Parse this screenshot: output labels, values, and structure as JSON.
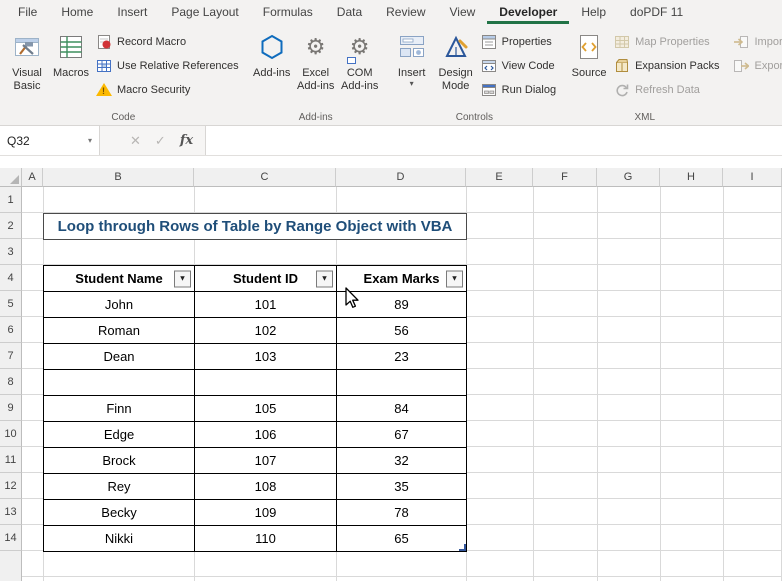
{
  "tabs": [
    {
      "label": "File"
    },
    {
      "label": "Home"
    },
    {
      "label": "Insert"
    },
    {
      "label": "Page Layout"
    },
    {
      "label": "Formulas"
    },
    {
      "label": "Data"
    },
    {
      "label": "Review"
    },
    {
      "label": "View"
    },
    {
      "label": "Developer",
      "active": true
    },
    {
      "label": "Help"
    },
    {
      "label": "doPDF 11"
    }
  ],
  "ribbon": {
    "code": {
      "group_label": "Code",
      "visual_basic": "Visual Basic",
      "macros": "Macros",
      "record_macro": "Record Macro",
      "use_relative_references": "Use Relative References",
      "macro_security": "Macro Security"
    },
    "addins": {
      "group_label": "Add-ins",
      "office_addins": "Add-ins",
      "excel_addins": "Excel Add-ins",
      "com_addins": "COM Add-ins"
    },
    "controls": {
      "group_label": "Controls",
      "insert": "Insert",
      "design_mode": "Design Mode",
      "properties": "Properties",
      "view_code": "View Code",
      "run_dialog": "Run Dialog"
    },
    "xml": {
      "group_label": "XML",
      "source": "Source",
      "map_properties": "Map Properties",
      "expansion_packs": "Expansion Packs",
      "refresh_data": "Refresh Data",
      "import": "Import",
      "export": "Export"
    }
  },
  "formula_bar": {
    "name_box": "Q32",
    "cancel": "✕",
    "enter": "✓",
    "insert_function": "fx",
    "formula_value": ""
  },
  "grid": {
    "column_headers": [
      "A",
      "B",
      "C",
      "D",
      "E",
      "F",
      "G",
      "H",
      "I"
    ],
    "row_headers": [
      "1",
      "2",
      "3",
      "4",
      "5",
      "6",
      "7",
      "8",
      "9",
      "10",
      "11",
      "12",
      "13",
      "14"
    ]
  },
  "sheet": {
    "title": "Loop through Rows of Table by Range Object with VBA",
    "table": {
      "headers": [
        "Student Name",
        "Student ID",
        "Exam Marks"
      ],
      "rows": [
        [
          "John",
          "101",
          "89"
        ],
        [
          "Roman",
          "102",
          "56"
        ],
        [
          "Dean",
          "103",
          "23"
        ],
        [
          "",
          "",
          ""
        ],
        [
          "Finn",
          "105",
          "84"
        ],
        [
          "Edge",
          "106",
          "67"
        ],
        [
          "Brock",
          "107",
          "32"
        ],
        [
          "Rey",
          "108",
          "35"
        ],
        [
          "Becky",
          "109",
          "78"
        ],
        [
          "Nikki",
          "110",
          "65"
        ]
      ]
    }
  },
  "icons": {
    "caret_down": "▾",
    "gear": "⚙",
    "exclamation": "!"
  },
  "colors": {
    "accent_green": "#217346",
    "title_text": "#1f4e79",
    "table_border": "#000000",
    "grid_line": "#d9d9d9"
  }
}
